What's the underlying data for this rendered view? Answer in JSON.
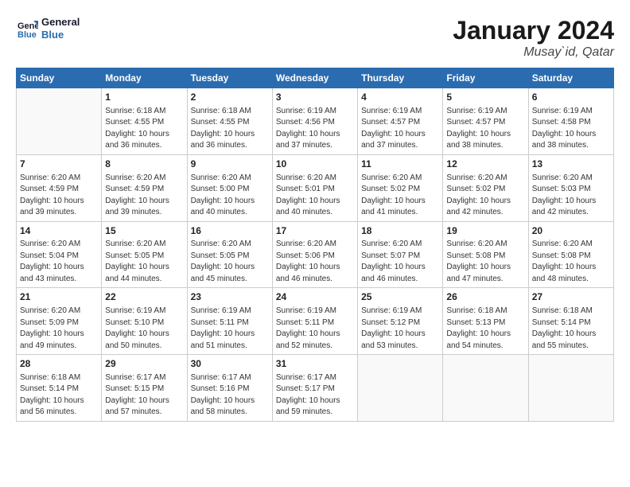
{
  "logo": {
    "line1": "General",
    "line2": "Blue"
  },
  "title": "January 2024",
  "location": "Musay`id, Qatar",
  "columns": [
    "Sunday",
    "Monday",
    "Tuesday",
    "Wednesday",
    "Thursday",
    "Friday",
    "Saturday"
  ],
  "weeks": [
    [
      {
        "day": "",
        "info": ""
      },
      {
        "day": "1",
        "info": "Sunrise: 6:18 AM\nSunset: 4:55 PM\nDaylight: 10 hours\nand 36 minutes."
      },
      {
        "day": "2",
        "info": "Sunrise: 6:18 AM\nSunset: 4:55 PM\nDaylight: 10 hours\nand 36 minutes."
      },
      {
        "day": "3",
        "info": "Sunrise: 6:19 AM\nSunset: 4:56 PM\nDaylight: 10 hours\nand 37 minutes."
      },
      {
        "day": "4",
        "info": "Sunrise: 6:19 AM\nSunset: 4:57 PM\nDaylight: 10 hours\nand 37 minutes."
      },
      {
        "day": "5",
        "info": "Sunrise: 6:19 AM\nSunset: 4:57 PM\nDaylight: 10 hours\nand 38 minutes."
      },
      {
        "day": "6",
        "info": "Sunrise: 6:19 AM\nSunset: 4:58 PM\nDaylight: 10 hours\nand 38 minutes."
      }
    ],
    [
      {
        "day": "7",
        "info": "Sunrise: 6:20 AM\nSunset: 4:59 PM\nDaylight: 10 hours\nand 39 minutes."
      },
      {
        "day": "8",
        "info": "Sunrise: 6:20 AM\nSunset: 4:59 PM\nDaylight: 10 hours\nand 39 minutes."
      },
      {
        "day": "9",
        "info": "Sunrise: 6:20 AM\nSunset: 5:00 PM\nDaylight: 10 hours\nand 40 minutes."
      },
      {
        "day": "10",
        "info": "Sunrise: 6:20 AM\nSunset: 5:01 PM\nDaylight: 10 hours\nand 40 minutes."
      },
      {
        "day": "11",
        "info": "Sunrise: 6:20 AM\nSunset: 5:02 PM\nDaylight: 10 hours\nand 41 minutes."
      },
      {
        "day": "12",
        "info": "Sunrise: 6:20 AM\nSunset: 5:02 PM\nDaylight: 10 hours\nand 42 minutes."
      },
      {
        "day": "13",
        "info": "Sunrise: 6:20 AM\nSunset: 5:03 PM\nDaylight: 10 hours\nand 42 minutes."
      }
    ],
    [
      {
        "day": "14",
        "info": "Sunrise: 6:20 AM\nSunset: 5:04 PM\nDaylight: 10 hours\nand 43 minutes."
      },
      {
        "day": "15",
        "info": "Sunrise: 6:20 AM\nSunset: 5:05 PM\nDaylight: 10 hours\nand 44 minutes."
      },
      {
        "day": "16",
        "info": "Sunrise: 6:20 AM\nSunset: 5:05 PM\nDaylight: 10 hours\nand 45 minutes."
      },
      {
        "day": "17",
        "info": "Sunrise: 6:20 AM\nSunset: 5:06 PM\nDaylight: 10 hours\nand 46 minutes."
      },
      {
        "day": "18",
        "info": "Sunrise: 6:20 AM\nSunset: 5:07 PM\nDaylight: 10 hours\nand 46 minutes."
      },
      {
        "day": "19",
        "info": "Sunrise: 6:20 AM\nSunset: 5:08 PM\nDaylight: 10 hours\nand 47 minutes."
      },
      {
        "day": "20",
        "info": "Sunrise: 6:20 AM\nSunset: 5:08 PM\nDaylight: 10 hours\nand 48 minutes."
      }
    ],
    [
      {
        "day": "21",
        "info": "Sunrise: 6:20 AM\nSunset: 5:09 PM\nDaylight: 10 hours\nand 49 minutes."
      },
      {
        "day": "22",
        "info": "Sunrise: 6:19 AM\nSunset: 5:10 PM\nDaylight: 10 hours\nand 50 minutes."
      },
      {
        "day": "23",
        "info": "Sunrise: 6:19 AM\nSunset: 5:11 PM\nDaylight: 10 hours\nand 51 minutes."
      },
      {
        "day": "24",
        "info": "Sunrise: 6:19 AM\nSunset: 5:11 PM\nDaylight: 10 hours\nand 52 minutes."
      },
      {
        "day": "25",
        "info": "Sunrise: 6:19 AM\nSunset: 5:12 PM\nDaylight: 10 hours\nand 53 minutes."
      },
      {
        "day": "26",
        "info": "Sunrise: 6:18 AM\nSunset: 5:13 PM\nDaylight: 10 hours\nand 54 minutes."
      },
      {
        "day": "27",
        "info": "Sunrise: 6:18 AM\nSunset: 5:14 PM\nDaylight: 10 hours\nand 55 minutes."
      }
    ],
    [
      {
        "day": "28",
        "info": "Sunrise: 6:18 AM\nSunset: 5:14 PM\nDaylight: 10 hours\nand 56 minutes."
      },
      {
        "day": "29",
        "info": "Sunrise: 6:17 AM\nSunset: 5:15 PM\nDaylight: 10 hours\nand 57 minutes."
      },
      {
        "day": "30",
        "info": "Sunrise: 6:17 AM\nSunset: 5:16 PM\nDaylight: 10 hours\nand 58 minutes."
      },
      {
        "day": "31",
        "info": "Sunrise: 6:17 AM\nSunset: 5:17 PM\nDaylight: 10 hours\nand 59 minutes."
      },
      {
        "day": "",
        "info": ""
      },
      {
        "day": "",
        "info": ""
      },
      {
        "day": "",
        "info": ""
      }
    ]
  ]
}
